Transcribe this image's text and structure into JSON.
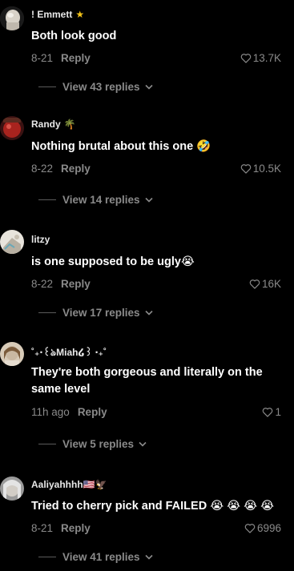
{
  "comments": [
    {
      "username": "! Emmett",
      "username_suffix": "★",
      "text": "Both look good",
      "date": "8-21",
      "reply_label": "Reply",
      "likes": "13.7K",
      "view_replies": "View 43 replies",
      "avatar_color": "#d8d2c8"
    },
    {
      "username": "Randy",
      "username_suffix": "🌴",
      "text": "Nothing brutal about this one 🤣",
      "date": "8-22",
      "reply_label": "Reply",
      "likes": "10.5K",
      "view_replies": "View 14 replies",
      "avatar_color": "#a8231e"
    },
    {
      "username": "litzy",
      "username_suffix": "",
      "text": "is one supposed to be ugly😭",
      "date": "8-22",
      "reply_label": "Reply",
      "likes": "16K",
      "view_replies": "View 17 replies",
      "avatar_color": "#d6d0c4"
    },
    {
      "username": "˚₊‧꒰ঌMiah໒꒱ ‧₊˚",
      "username_suffix": "",
      "text": "They're both gorgeous and literally on the same level",
      "date": "11h ago",
      "reply_label": "Reply",
      "likes": "1",
      "view_replies": "View 5 replies",
      "avatar_color": "#c9b8a2"
    },
    {
      "username": "Aaliyahhhh🇺🇸🦅",
      "username_suffix": "",
      "text": "Tried to cherry pick and FAILED 😭 😭 😭 😭",
      "date": "8-21",
      "reply_label": "Reply",
      "likes": "6996",
      "view_replies": "View 41 replies",
      "avatar_color": "#bdbdbd"
    }
  ],
  "colors": {
    "background": "#000000",
    "muted_text": "#8a8a8a",
    "primary_text": "#ffffff",
    "star": "#f5c518"
  },
  "icons": {
    "like": "heart-outline-icon",
    "expand": "chevron-down-icon"
  }
}
